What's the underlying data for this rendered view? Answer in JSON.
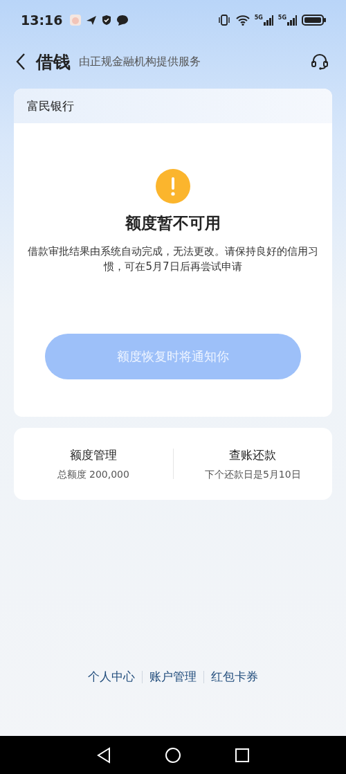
{
  "status_bar": {
    "time": "13:16",
    "network_labels": [
      "5G",
      "5G"
    ]
  },
  "header": {
    "title": "借钱",
    "subtitle": "由正规金融机构提供服务"
  },
  "bank_card": {
    "bank_name": "富民银行",
    "status_title": "额度暂不可用",
    "message": "借款审批结果由系统自动完成，无法更改。请保持良好的信用习惯，可在5月7日后再尝试申请",
    "button": {
      "label": "额度恢复时将通知你",
      "disabled": true
    }
  },
  "summary": [
    {
      "title": "额度管理",
      "detail": "总额度 200,000"
    },
    {
      "title": "查账还款",
      "detail": "下个还款日是5月10日"
    }
  ],
  "footer_links": [
    "个人中心",
    "账户管理",
    "红包卡券"
  ]
}
